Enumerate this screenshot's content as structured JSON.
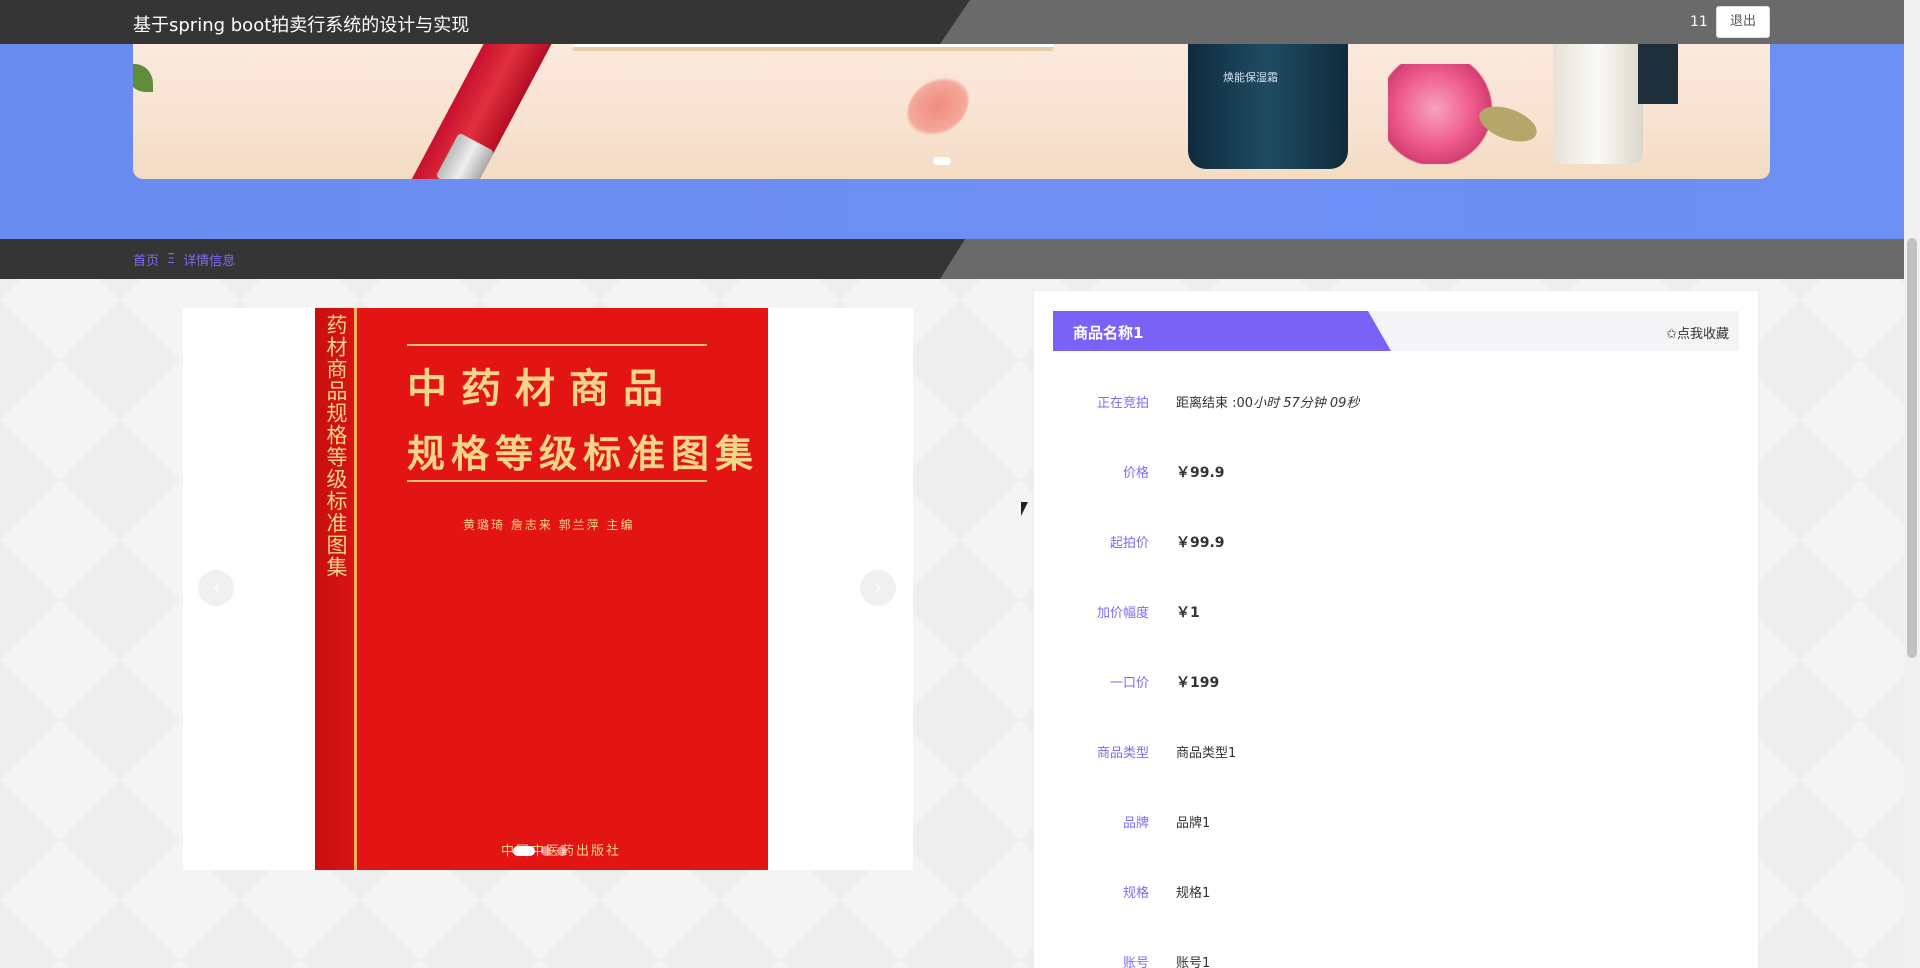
{
  "header": {
    "title": "基于spring boot拍卖行系统的设计与实现",
    "username": "11",
    "logout_label": "退出"
  },
  "banner": {
    "jar_text": "焕能保湿霜"
  },
  "breadcrumb": {
    "home": "首页",
    "separator": "Ξ",
    "current": "详情信息"
  },
  "gallery": {
    "prev_icon": "‹",
    "next_icon": "›",
    "book": {
      "spine": "药材商品规格等级标准图集",
      "title_line1": "中药材商品",
      "title_line2": "规格等级标准图集",
      "authors": "黄璐琦  詹志来  郭兰萍  主编",
      "publisher": "中国中医药出版社"
    }
  },
  "detail": {
    "product_name": "商品名称1",
    "favorite_label": "✩点我收藏",
    "rows": [
      {
        "label": "正在竞拍",
        "value_prefix": "距离结束 :00",
        "value_italic": "小时 57分钟 09秒"
      },
      {
        "label": "价格",
        "value": "￥99.9"
      },
      {
        "label": "起拍价",
        "value": "￥99.9"
      },
      {
        "label": "加价幅度",
        "value": "￥1"
      },
      {
        "label": "一口价",
        "value": "￥199"
      },
      {
        "label": "商品类型",
        "value": "商品类型1"
      },
      {
        "label": "品牌",
        "value": "品牌1"
      },
      {
        "label": "规格",
        "value": "规格1"
      },
      {
        "label": "账号",
        "value": "账号1"
      }
    ]
  }
}
